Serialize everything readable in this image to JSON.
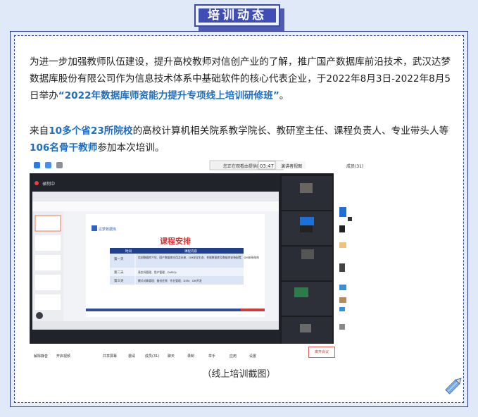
{
  "section_title": "培训动态",
  "paragraph1": {
    "text_a": "为进一步加强教师队伍建设，提升高校教师对信创产业的了解，推广国产数据库前沿技术，武汉达梦数据库股份有限公司作为信息技术体系中基础软件的核心代表企业，于2022年8月3日-2022年8月5日举办",
    "highlight": "“2022年数据库师资能力提升专项线上培训研修班”",
    "text_b": "。"
  },
  "paragraph2": {
    "lead": "来自",
    "hl1": "10多个省23所院校",
    "mid": "的高校计算机相关院系教学院长、教研室主任、课程负责人、专业带头人等",
    "hl2": "106名骨干教师",
    "tail": "参加本次培训。"
  },
  "screenshot": {
    "screen_share_notice": "您正在观看由提供的屏幕",
    "timer": "03:47",
    "view_label": "演讲者视图",
    "members_label": "成员(31)",
    "recording_label": "录制中",
    "slide_logo": "达梦数据库",
    "slide_title": "课程安排",
    "table_headers": [
      "时间",
      "课程内容"
    ],
    "table_rows": [
      {
        "time": "第一天",
        "content": "信创数据库介绍、国产数据库应用及未来、DM安全生态、性能数据库及数据库安装配置、DM体系结构"
      },
      {
        "time": "第二天",
        "content": "表空间管理、用户管理、DMSQL"
      },
      {
        "time": "第三天",
        "content": "模式对象管理、备份还原、作业管理、DEM、DM开发"
      }
    ],
    "toolbar": [
      "解除静音",
      "开启视频",
      "共享屏幕",
      "邀请",
      "成员(31)",
      "聊天",
      "录制",
      "举手",
      "应用",
      "设置"
    ],
    "leave_button": "离开会议"
  },
  "caption": "（线上培训截图）"
}
